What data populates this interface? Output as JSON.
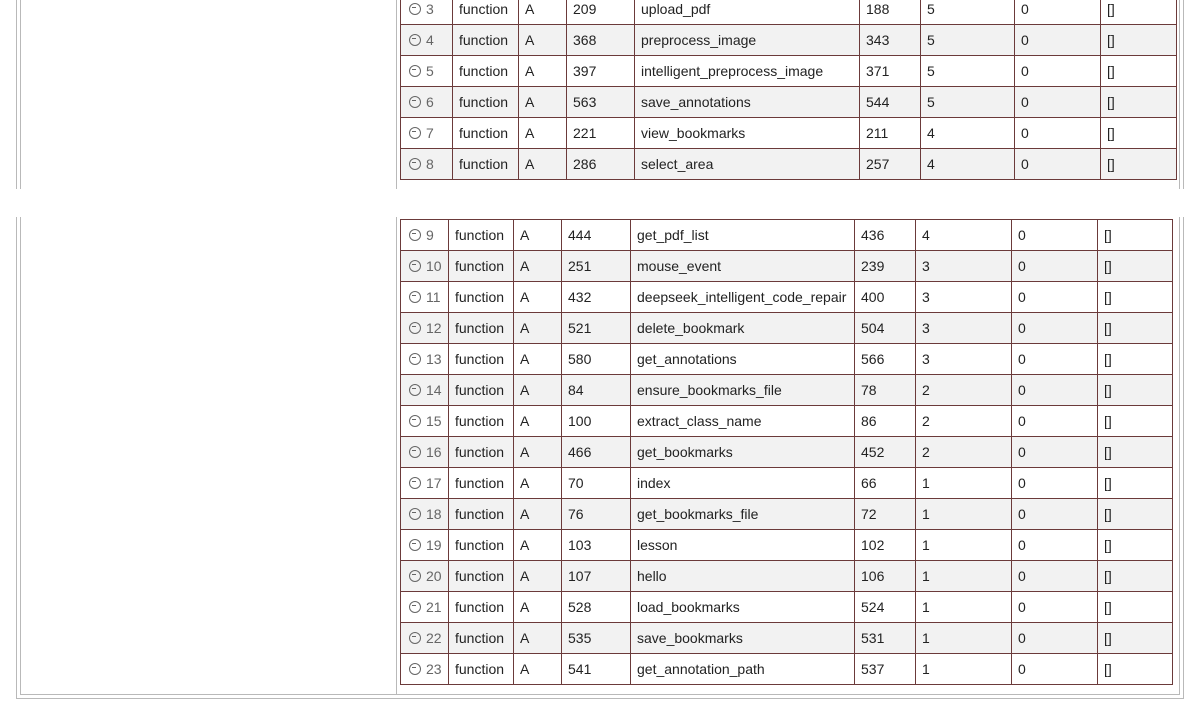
{
  "rows_top": [
    {
      "num": "3",
      "type": "function",
      "grade": "A",
      "line_end": "209",
      "name": "upload_pdf",
      "line_start": "188",
      "complexity": "5",
      "nested": "0",
      "closures": "[]"
    },
    {
      "num": "4",
      "type": "function",
      "grade": "A",
      "line_end": "368",
      "name": "preprocess_image",
      "line_start": "343",
      "complexity": "5",
      "nested": "0",
      "closures": "[]"
    },
    {
      "num": "5",
      "type": "function",
      "grade": "A",
      "line_end": "397",
      "name": "intelligent_preprocess_image",
      "line_start": "371",
      "complexity": "5",
      "nested": "0",
      "closures": "[]"
    },
    {
      "num": "6",
      "type": "function",
      "grade": "A",
      "line_end": "563",
      "name": "save_annotations",
      "line_start": "544",
      "complexity": "5",
      "nested": "0",
      "closures": "[]"
    },
    {
      "num": "7",
      "type": "function",
      "grade": "A",
      "line_end": "221",
      "name": "view_bookmarks",
      "line_start": "211",
      "complexity": "4",
      "nested": "0",
      "closures": "[]"
    },
    {
      "num": "8",
      "type": "function",
      "grade": "A",
      "line_end": "286",
      "name": "select_area",
      "line_start": "257",
      "complexity": "4",
      "nested": "0",
      "closures": "[]"
    }
  ],
  "rows_bottom": [
    {
      "num": "9",
      "type": "function",
      "grade": "A",
      "line_end": "444",
      "name": "get_pdf_list",
      "line_start": "436",
      "complexity": "4",
      "nested": "0",
      "closures": "[]"
    },
    {
      "num": "10",
      "type": "function",
      "grade": "A",
      "line_end": "251",
      "name": "mouse_event",
      "line_start": "239",
      "complexity": "3",
      "nested": "0",
      "closures": "[]"
    },
    {
      "num": "11",
      "type": "function",
      "grade": "A",
      "line_end": "432",
      "name": "deepseek_intelligent_code_repair",
      "line_start": "400",
      "complexity": "3",
      "nested": "0",
      "closures": "[]"
    },
    {
      "num": "12",
      "type": "function",
      "grade": "A",
      "line_end": "521",
      "name": "delete_bookmark",
      "line_start": "504",
      "complexity": "3",
      "nested": "0",
      "closures": "[]"
    },
    {
      "num": "13",
      "type": "function",
      "grade": "A",
      "line_end": "580",
      "name": "get_annotations",
      "line_start": "566",
      "complexity": "3",
      "nested": "0",
      "closures": "[]"
    },
    {
      "num": "14",
      "type": "function",
      "grade": "A",
      "line_end": "84",
      "name": "ensure_bookmarks_file",
      "line_start": "78",
      "complexity": "2",
      "nested": "0",
      "closures": "[]"
    },
    {
      "num": "15",
      "type": "function",
      "grade": "A",
      "line_end": "100",
      "name": "extract_class_name",
      "line_start": "86",
      "complexity": "2",
      "nested": "0",
      "closures": "[]"
    },
    {
      "num": "16",
      "type": "function",
      "grade": "A",
      "line_end": "466",
      "name": "get_bookmarks",
      "line_start": "452",
      "complexity": "2",
      "nested": "0",
      "closures": "[]"
    },
    {
      "num": "17",
      "type": "function",
      "grade": "A",
      "line_end": "70",
      "name": "index",
      "line_start": "66",
      "complexity": "1",
      "nested": "0",
      "closures": "[]"
    },
    {
      "num": "18",
      "type": "function",
      "grade": "A",
      "line_end": "76",
      "name": "get_bookmarks_file",
      "line_start": "72",
      "complexity": "1",
      "nested": "0",
      "closures": "[]"
    },
    {
      "num": "19",
      "type": "function",
      "grade": "A",
      "line_end": "103",
      "name": "lesson",
      "line_start": "102",
      "complexity": "1",
      "nested": "0",
      "closures": "[]"
    },
    {
      "num": "20",
      "type": "function",
      "grade": "A",
      "line_end": "107",
      "name": "hello",
      "line_start": "106",
      "complexity": "1",
      "nested": "0",
      "closures": "[]"
    },
    {
      "num": "21",
      "type": "function",
      "grade": "A",
      "line_end": "528",
      "name": "load_bookmarks",
      "line_start": "524",
      "complexity": "1",
      "nested": "0",
      "closures": "[]"
    },
    {
      "num": "22",
      "type": "function",
      "grade": "A",
      "line_end": "535",
      "name": "save_bookmarks",
      "line_start": "531",
      "complexity": "1",
      "nested": "0",
      "closures": "[]"
    },
    {
      "num": "23",
      "type": "function",
      "grade": "A",
      "line_end": "541",
      "name": "get_annotation_path",
      "line_start": "537",
      "complexity": "1",
      "nested": "0",
      "closures": "[]"
    }
  ],
  "row_icon": "circle-minus-icon"
}
